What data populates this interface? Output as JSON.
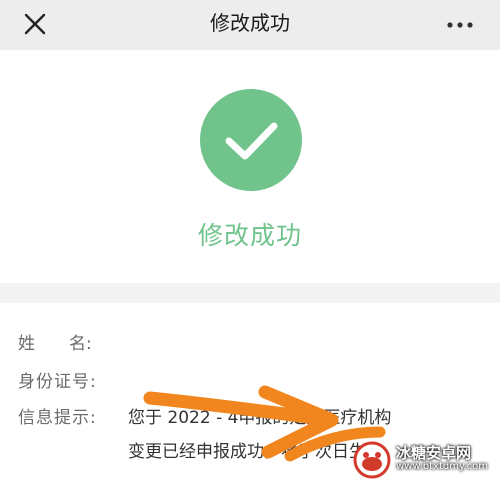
{
  "header": {
    "title": "修改成功",
    "close_icon": "close-icon",
    "more_icon": "more-dots-icon"
  },
  "result": {
    "icon": "check-circle-icon",
    "icon_color": "#6fc38b",
    "text": "修改成功",
    "text_color": "#6fc38b"
  },
  "info": {
    "name_label": "姓　　名:",
    "id_label": "身份证号:",
    "tip_label": "信息提示:",
    "tip_line1": "您于 2022 -          4申报的定点医疗机构",
    "tip_line2": "变更已经申报成功，将于次日生"
  },
  "annotation": {
    "color": "#f2861e",
    "shape": "arrow-annotation"
  },
  "watermark": {
    "title": "冰糖安卓网",
    "url": "www.btxtdmy.com"
  }
}
